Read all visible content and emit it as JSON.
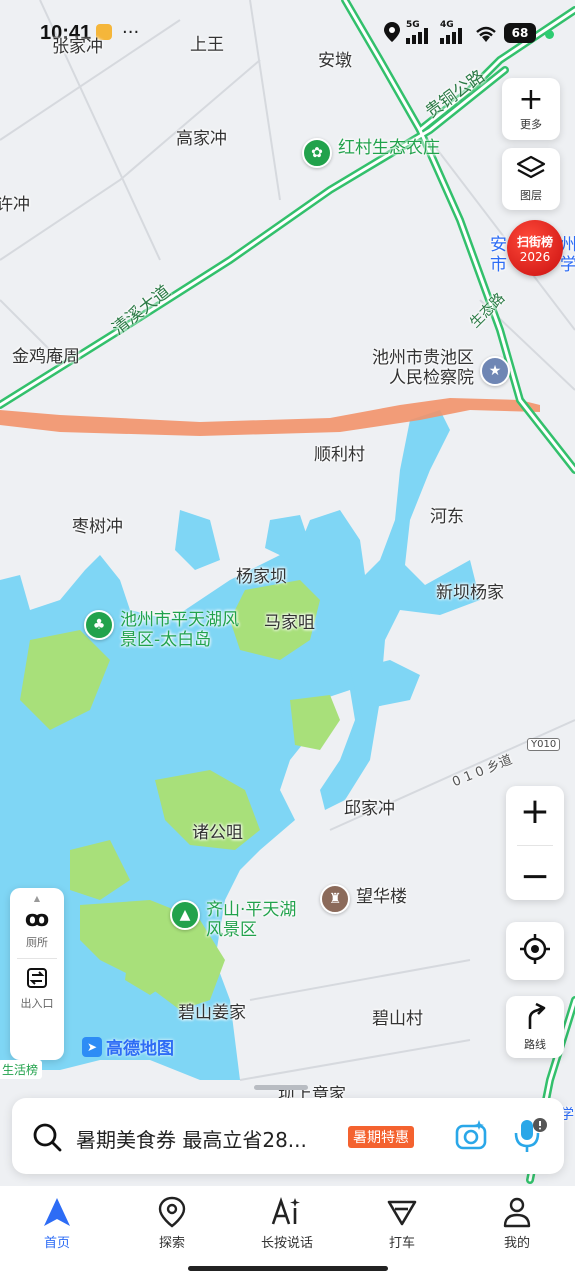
{
  "status_bar": {
    "time": "10:41",
    "menu_dots": "···",
    "network_label_1": "5G",
    "network_label_2": "4G",
    "battery": "68"
  },
  "map_labels": {
    "zhangjiachong": "张家冲",
    "shangwang": "上王",
    "andun": "安墩",
    "gaojiachong": "高家冲",
    "xuchong": "许冲",
    "jinjianzhou": "金鸡庵周",
    "qingxi_avenue": "清溪大道",
    "guitong_road": "贵铜公路",
    "shengtai_road": "生态路",
    "shunlicun": "顺利村",
    "zaoshuchong": "枣树冲",
    "hedong": "河东",
    "yangjiaba": "杨家坝",
    "xinbayangjia": "新坝杨家",
    "majiazui": "马家咀",
    "road_010": "0 1 0 乡道",
    "road_badge": "Y010",
    "qiujiachong": "邱家冲",
    "zhugongzui": "诸公咀",
    "bishanjiangjia": "碧山姜家",
    "bishancun": "碧山村",
    "batshangzhangjia": "坝上章家",
    "an_partial_1": "安",
    "an_partial_2": "市",
    "xue_partial_1": "州",
    "xue_partial_2": "学",
    "xue_partial_3": "学"
  },
  "pois": {
    "hongcun": "红村生态农庄",
    "procuratorate": "池州市贵池区\n人民检察院",
    "taibai": "池州市平天湖风\n景区-太白岛",
    "qishan": "齐山·平天湖\n风景区",
    "wanghualou": "望华楼"
  },
  "controls": {
    "more_label": "更多",
    "layers_label": "图层",
    "scan_badge_line1": "扫街榜",
    "scan_badge_line2": "2026",
    "toilet_label": "厕所",
    "entrance_label": "出入口",
    "route_label": "路线"
  },
  "brand": {
    "amap_logo": "高德地图",
    "life_list": "生活榜"
  },
  "search": {
    "placeholder_text": "暑期美食券 最高立省28...",
    "promo_tag": "暑期特惠"
  },
  "tabs": [
    {
      "label": "首页",
      "active": true
    },
    {
      "label": "探索",
      "active": false
    },
    {
      "label": "长按说话",
      "active": false
    },
    {
      "label": "打车",
      "active": false
    },
    {
      "label": "我的",
      "active": false
    }
  ],
  "colors": {
    "accent": "#2d6cf5",
    "water": "#7fd6f5",
    "park_green": "#a8e07a",
    "road_green": "#33c06c",
    "traffic_orange": "#f2926a",
    "promo_tag": "#f4622f"
  }
}
